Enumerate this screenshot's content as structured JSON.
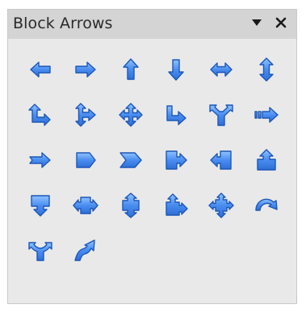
{
  "panel": {
    "title": "Block Arrows",
    "menu_icon": "triangle-down",
    "close_icon": "close-x",
    "accent_color": "#4a8df0",
    "header_bg": "#d4d4d4",
    "panel_bg": "#e9e9e9"
  },
  "shapes": [
    "left-arrow",
    "right-arrow",
    "up-arrow",
    "down-arrow",
    "left-right-arrow",
    "up-down-arrow",
    "up-right-arrow",
    "up-right-down-arrow",
    "4-way-arrow",
    "corner-right-arrow",
    "split-arrow",
    "striped-right-arrow",
    "notched-right-arrow",
    "pentagon",
    "chevron",
    "right-arrow-callout",
    "left-arrow-callout",
    "up-arrow-callout",
    "down-arrow-callout",
    "left-right-arrow-callout",
    "up-down-arrow-callout",
    "up-right-arrow-callout",
    "4-way-arrow-callout",
    "circular-arrow",
    "split-round-arrow",
    "s-shaped-arrow"
  ]
}
